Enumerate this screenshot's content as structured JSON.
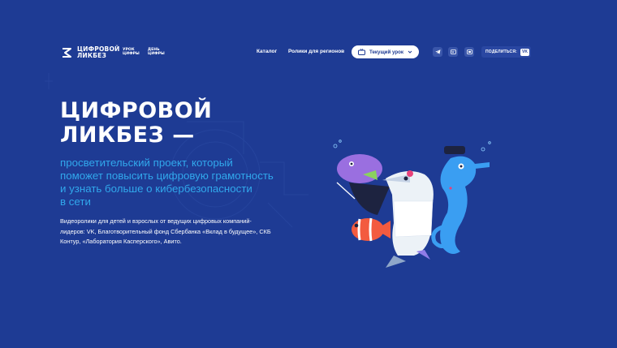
{
  "brand": {
    "logo_text": "ЦИФРОВОЙ\nЛИКБЕЗ",
    "project_links": [
      "УРОК\nЦИФРЫ",
      "ДЕНЬ\nЦИФРЫ"
    ]
  },
  "nav": {
    "catalog": "Каталог",
    "regions": "Ролики для регионов",
    "current_lesson": "Текущий урок"
  },
  "social": {
    "icons": [
      "telegram-icon",
      "vk-icon",
      "ok-icon"
    ],
    "share_label": "ПОДЕЛИТЬСЯ:",
    "share_vk": "VK"
  },
  "hero": {
    "title": "ЦИФРОВОЙ\nЛИКБЕЗ —",
    "subtitle": "просветительский проект, который\nпоможет повысить цифровую грамотность\nи узнать больше о кибербезопасности\nв сети",
    "description": "Видеоролики для детей и взрослых от ведущих цифровых компаний-\nлидеров: VK, Благотворительный фонд Сбербанка «Вклад в будущее», СКБ\nКонтур, «Лаборатория Касперского», Авито."
  },
  "colors": {
    "background": "#1e3b94",
    "accent": "#31a8ec",
    "button": "#ffffff"
  }
}
